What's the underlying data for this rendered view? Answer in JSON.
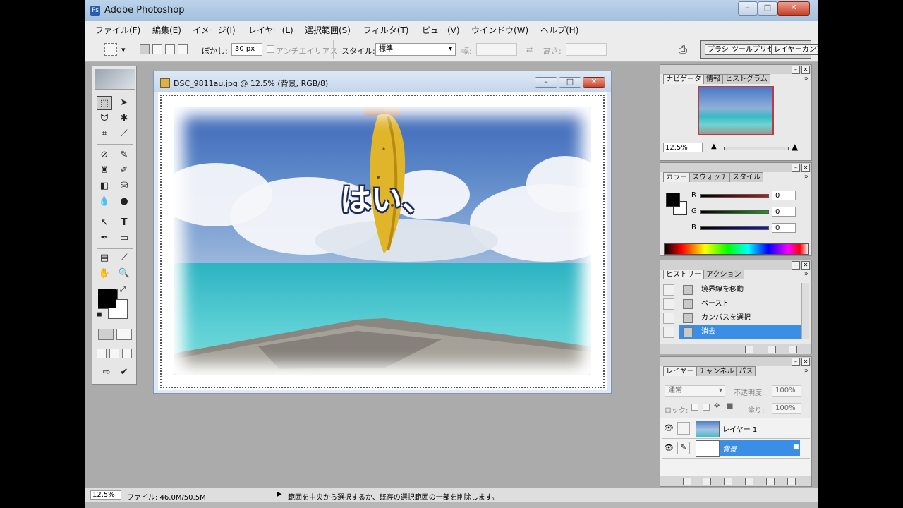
{
  "app": {
    "title": "Adobe Photoshop",
    "window_buttons": {
      "minimize": "–",
      "maximize": "□",
      "close": "✕"
    }
  },
  "menu": [
    "ファイル(F)",
    "編集(E)",
    "イメージ(I)",
    "レイヤー(L)",
    "選択範囲(S)",
    "フィルタ(T)",
    "ビュー(V)",
    "ウインドウ(W)",
    "ヘルプ(H)"
  ],
  "options": {
    "feather_label": "ぼかし:",
    "feather_value": "30 px",
    "antialias_label": "アンチエイリアス",
    "style_label": "スタイル:",
    "style_value": "標準",
    "width_label": "幅:",
    "height_label": "高さ:",
    "palette_well": [
      "ブラシ",
      "ツールプリセット",
      "レイヤーカンプ"
    ]
  },
  "document": {
    "title": "DSC_9811au.jpg @ 12.5% (背景, RGB/8)",
    "caption": "はい、"
  },
  "navigator": {
    "tabs": [
      "ナビゲータ",
      "情報",
      "ヒストグラム"
    ],
    "zoom": "12.5%"
  },
  "color": {
    "tabs": [
      "カラー",
      "スウォッチ",
      "スタイル"
    ],
    "channels": [
      {
        "label": "R",
        "value": "0",
        "color": "#c01818"
      },
      {
        "label": "G",
        "value": "0",
        "color": "#18a018"
      },
      {
        "label": "B",
        "value": "0",
        "color": "#1818c0"
      }
    ]
  },
  "history": {
    "tabs": [
      "ヒストリー",
      "アクション"
    ],
    "items": [
      "境界線を移動",
      "ペースト",
      "カンバスを選択",
      "消去"
    ],
    "selected_index": 3
  },
  "layers": {
    "tabs": [
      "レイヤー",
      "チャンネル",
      "パス"
    ],
    "blend_mode": "通常",
    "opacity_label": "不透明度:",
    "opacity_value": "100%",
    "lock_label": "ロック:",
    "fill_label": "塗り:",
    "fill_value": "100%",
    "items": [
      {
        "name": "レイヤー 1",
        "selected": false
      },
      {
        "name": "背景",
        "selected": true
      }
    ]
  },
  "status": {
    "zoom": "12.5%",
    "file_size": "ファイル: 46.0M/50.5M",
    "message": "範囲を中央から選択するか、既存の選択範囲の一部を削除します。"
  },
  "colors": {
    "selection_blue": "#3a8ee6",
    "navigator_frame": "#c0393f"
  }
}
